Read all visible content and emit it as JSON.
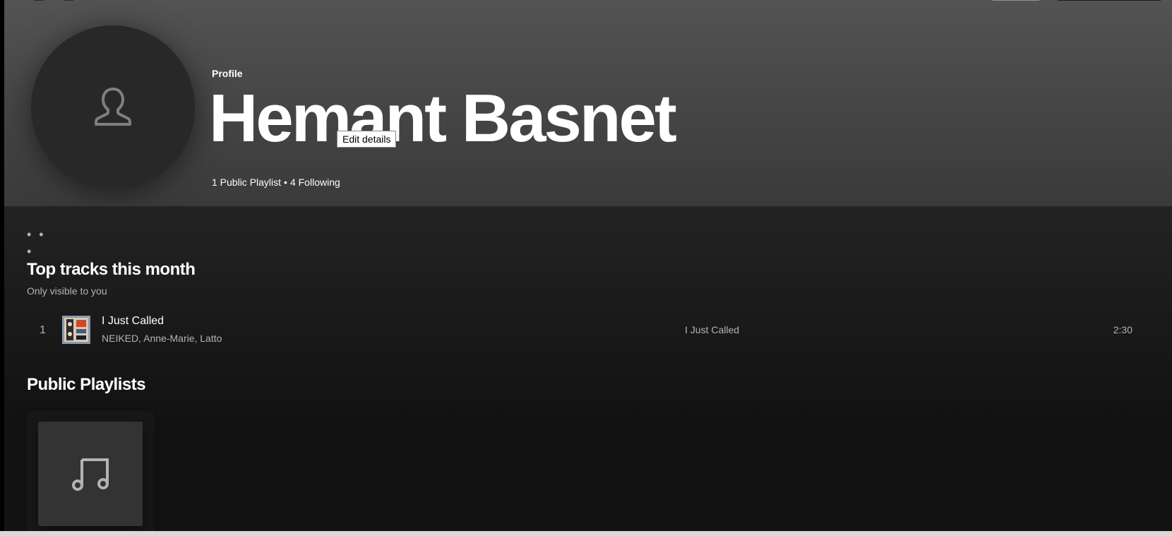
{
  "profile": {
    "type_label": "Profile",
    "name": "Hemant Basnet",
    "edit_tooltip": "Edit details",
    "public_playlists": "1 Public Playlist",
    "separator": "•",
    "following": "4 Following",
    "avatar_icon": "user-icon"
  },
  "actions": {
    "more_label": "• • •"
  },
  "top_tracks": {
    "title": "Top tracks this month",
    "subtitle": "Only visible to you",
    "tracks": [
      {
        "number": "1",
        "title": "I Just Called",
        "artists": "NEIKED, Anne-Marie, Latto",
        "album": "I Just Called",
        "duration": "2:30"
      }
    ]
  },
  "public_playlists": {
    "title": "Public Playlists",
    "cover_icon": "music-note-icon"
  },
  "colors": {
    "background": "#121212",
    "header_gradient_top": "#535353",
    "header_gradient_bottom": "#3a3a3a",
    "text_primary": "#ffffff",
    "text_secondary": "#b3b3b3",
    "card": "#181818"
  }
}
